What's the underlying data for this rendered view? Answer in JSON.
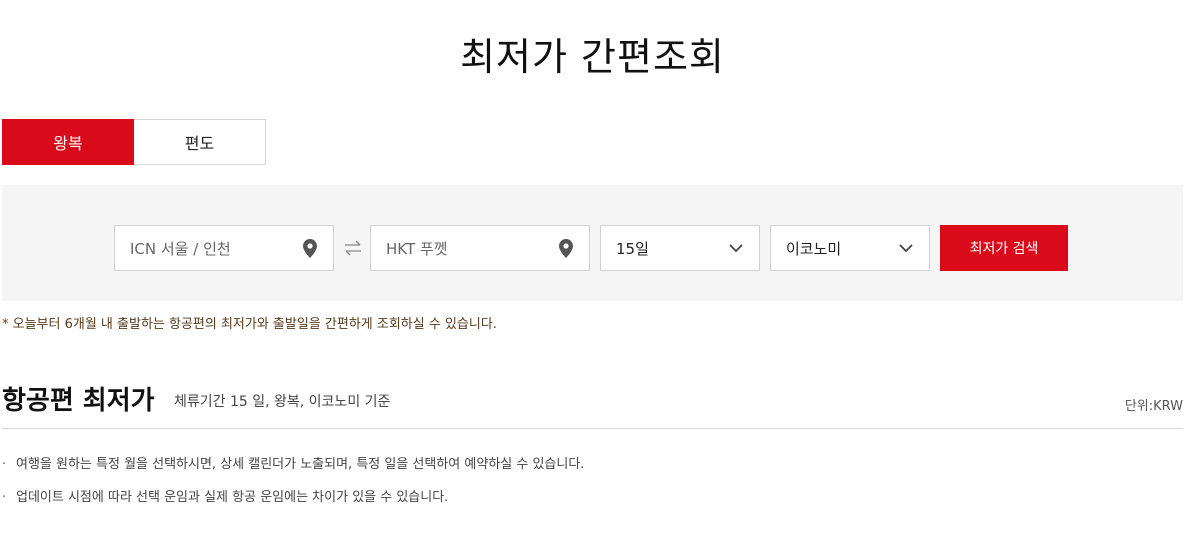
{
  "page": {
    "title": "최저가 간편조회"
  },
  "trip_tabs": [
    {
      "label": "왕복",
      "active": true
    },
    {
      "label": "편도",
      "active": false
    }
  ],
  "search": {
    "origin": "ICN 서울 / 인천",
    "destination": "HKT 푸껫",
    "stay": "15일",
    "cabin": "이코노미",
    "button_label": "최저가 검색"
  },
  "notice": "* 오늘부터 6개월 내 출발하는 항공편의 최저가와 출발일을 간편하게 조회하실 수 있습니다.",
  "results": {
    "title": "항공편 최저가",
    "subtitle": "체류기간 15 일, 왕복, 이코노미 기준",
    "unit": "단위:KRW"
  },
  "bullets": [
    "여행을 원하는 특정 월을 선택하시면, 상세 캘린더가 노출되며, 특정 일을 선택하여 예약하실 수 있습니다.",
    "업데이트 시점에 따라 선택 운임과 실제 항공 운임에는 차이가 있을 수 있습니다."
  ],
  "colors": {
    "accent": "#d90b1a",
    "panel_bg": "#f5f5f5"
  },
  "icons": {
    "location": "map-pin-icon",
    "swap": "swap-arrows-icon",
    "dropdown": "chevron-down-icon"
  }
}
